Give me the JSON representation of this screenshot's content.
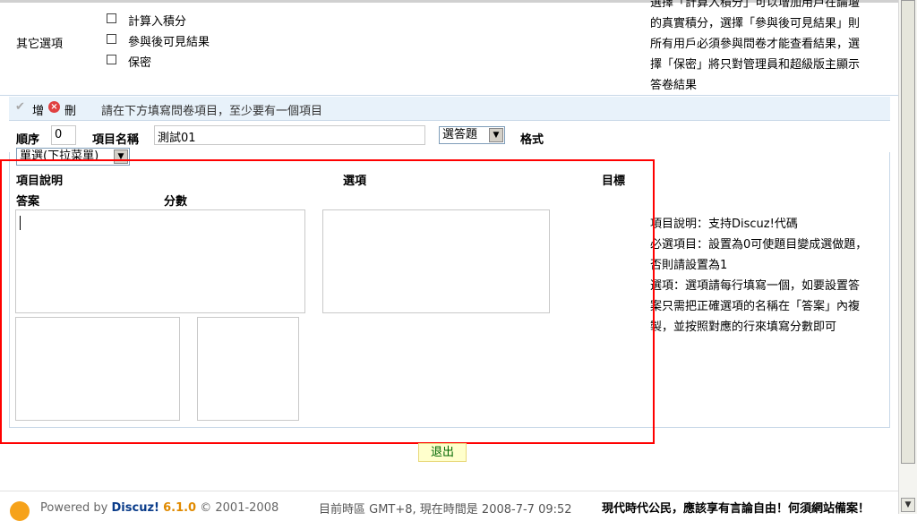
{
  "other_options": {
    "label": "其它選項",
    "options": [
      "計算入積分",
      "參與後可見結果",
      "保密"
    ],
    "help_lines": [
      "選擇「計算入積分」可以增加用戶在論壇",
      "的真實積分，選擇「參與後可見結果」則",
      "所有用戶必須參與問卷才能查看結果，選",
      "擇「保密」將只對管理員和超級版主顯示",
      "答卷結果"
    ]
  },
  "toolbar": {
    "add_label": "增",
    "delete_label": "刪",
    "hint": "請在下方填寫問卷項目，至少要有一個項目"
  },
  "item": {
    "order_label": "順序",
    "order_value": "0",
    "name_label": "項目名稱",
    "name_value": "測試01",
    "type_value": "選答題",
    "format_label": "格式",
    "format_value": "單選(下拉菜單)",
    "desc_label": "項目說明",
    "options_label": "選項",
    "target_label": "目標",
    "answer_label": "答案",
    "score_label": "分數"
  },
  "help": {
    "lines": [
      "項目說明：支持Discuz!代碼",
      "必選項目：設置為0可使題目變成選做題，",
      "否則請設置為1",
      "選項：選項請每行填寫一個，如要設置答",
      "案只需把正確選項的名稱在「答案」內複",
      "製，並按照對應的行來填寫分數即可"
    ]
  },
  "exit_button": "退出",
  "footer": {
    "powered_by": "Powered by",
    "brand": "Discuz!",
    "version": "6.1.0",
    "copyright": "© 2001-2008",
    "time_text": "目前時區 GMT+8, 現在時間是 2008-7-7 09:52",
    "slogan": "現代時代公民，應該享有言論自由！何須網站備案！"
  },
  "colors": {
    "highlight_box": "#ff0000",
    "toolbar_bg": "#e8f2fa",
    "exit_bg": "#ffffcc",
    "brand": "#0a3c8a",
    "version": "#e08a00"
  }
}
